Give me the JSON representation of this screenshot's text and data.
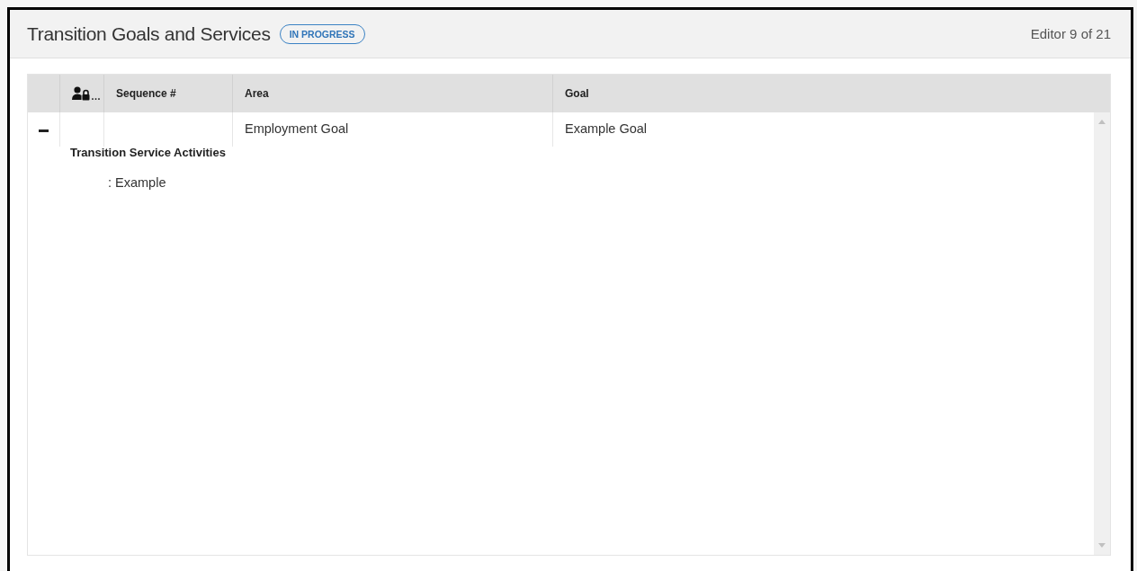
{
  "header": {
    "title": "Transition Goals and Services",
    "status_badge": "IN PROGRESS",
    "editor_position": "Editor 9 of 21"
  },
  "table": {
    "columns": [
      {
        "kind": "expander"
      },
      {
        "kind": "icon",
        "label": "…"
      },
      {
        "kind": "text",
        "label": "Sequence #"
      },
      {
        "kind": "text",
        "label": "Area"
      },
      {
        "kind": "text",
        "label": "Goal"
      }
    ],
    "rows": [
      {
        "expanded": true,
        "cells": [
          "",
          "",
          "",
          "Employment Goal",
          "Example Goal"
        ],
        "detail": {
          "heading": "Transition Service Activities",
          "items": [
            ": Example"
          ]
        }
      }
    ]
  }
}
